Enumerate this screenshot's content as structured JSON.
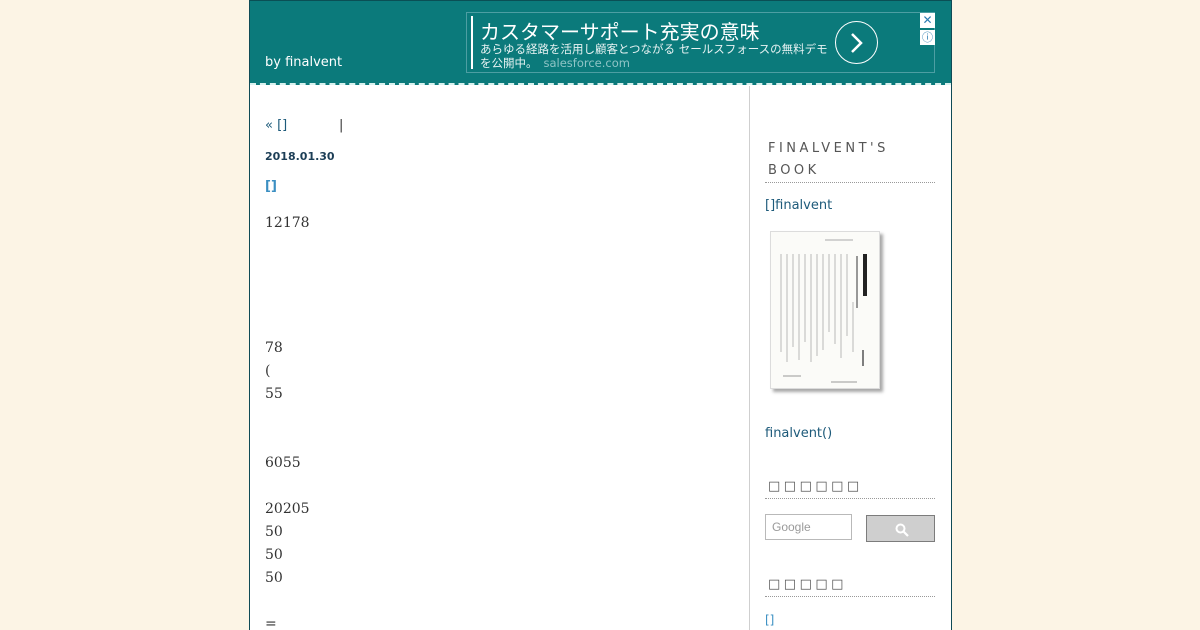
{
  "header": {
    "byline": "by finalvent"
  },
  "ad": {
    "title": "カスタマーサポート充実の意味",
    "description": "あらゆる経路を活用し顧客とつながる セールスフォースの無料デモを公開中。",
    "domain": "salesforce.com",
    "close_label": "✕",
    "info_label": "ⓘ"
  },
  "post": {
    "nav_prev": "« []",
    "nav_sep": "|",
    "date": "2018.01.30",
    "title": "[]",
    "lines": [
      "12178",
      "78",
      "(",
      "55",
      "6055",
      "20205",
      "50",
      "50",
      "50",
      "="
    ]
  },
  "sidebar": {
    "book_heading": "FINALVENT'S BOOK",
    "book_link": "[]finalvent",
    "book_cover_title": "考える生き方",
    "author_link": "finalvent()",
    "search_heading": "□□□□□□",
    "search_placeholder": "Google",
    "recent_heading": "□□□□□",
    "recent_first": "[]"
  }
}
